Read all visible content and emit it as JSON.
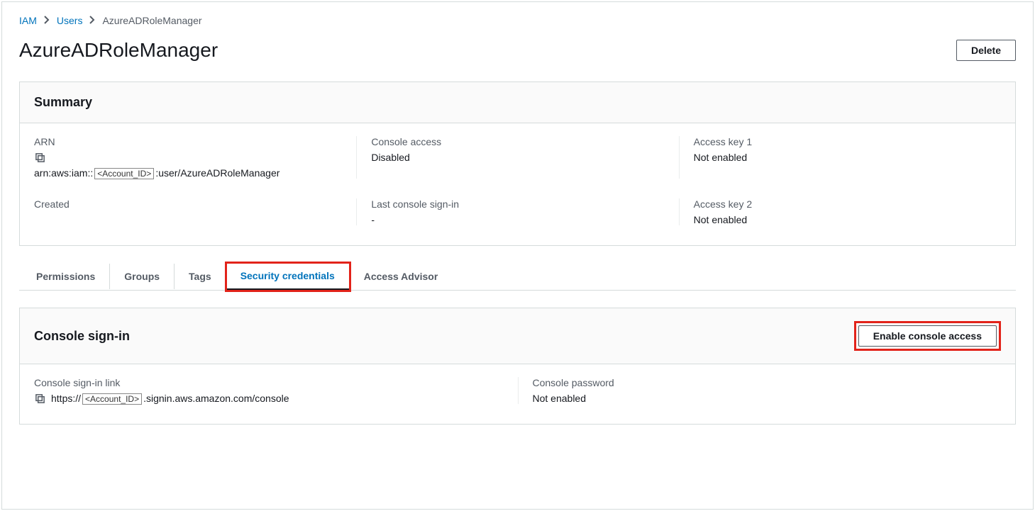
{
  "breadcrumb": {
    "items": [
      "IAM",
      "Users"
    ],
    "current": "AzureADRoleManager"
  },
  "page": {
    "title": "AzureADRoleManager",
    "delete_label": "Delete"
  },
  "summary": {
    "heading": "Summary",
    "arn_label": "ARN",
    "arn_prefix": "arn:aws:iam::",
    "arn_account_placeholder": "<Account_ID>",
    "arn_suffix": ":user/AzureADRoleManager",
    "console_access_label": "Console access",
    "console_access_value": "Disabled",
    "access_key1_label": "Access key 1",
    "access_key1_value": "Not enabled",
    "created_label": "Created",
    "created_value": "",
    "last_signin_label": "Last console sign-in",
    "last_signin_value": "-",
    "access_key2_label": "Access key 2",
    "access_key2_value": "Not enabled"
  },
  "tabs": {
    "permissions": "Permissions",
    "groups": "Groups",
    "tags": "Tags",
    "security_credentials": "Security credentials",
    "access_advisor": "Access Advisor"
  },
  "console_signin": {
    "heading": "Console sign-in",
    "enable_label": "Enable console access",
    "link_label": "Console sign-in link",
    "link_prefix": "https://",
    "link_account_placeholder": "<Account_ID>",
    "link_suffix": ".signin.aws.amazon.com/console",
    "password_label": "Console password",
    "password_value": "Not enabled"
  }
}
